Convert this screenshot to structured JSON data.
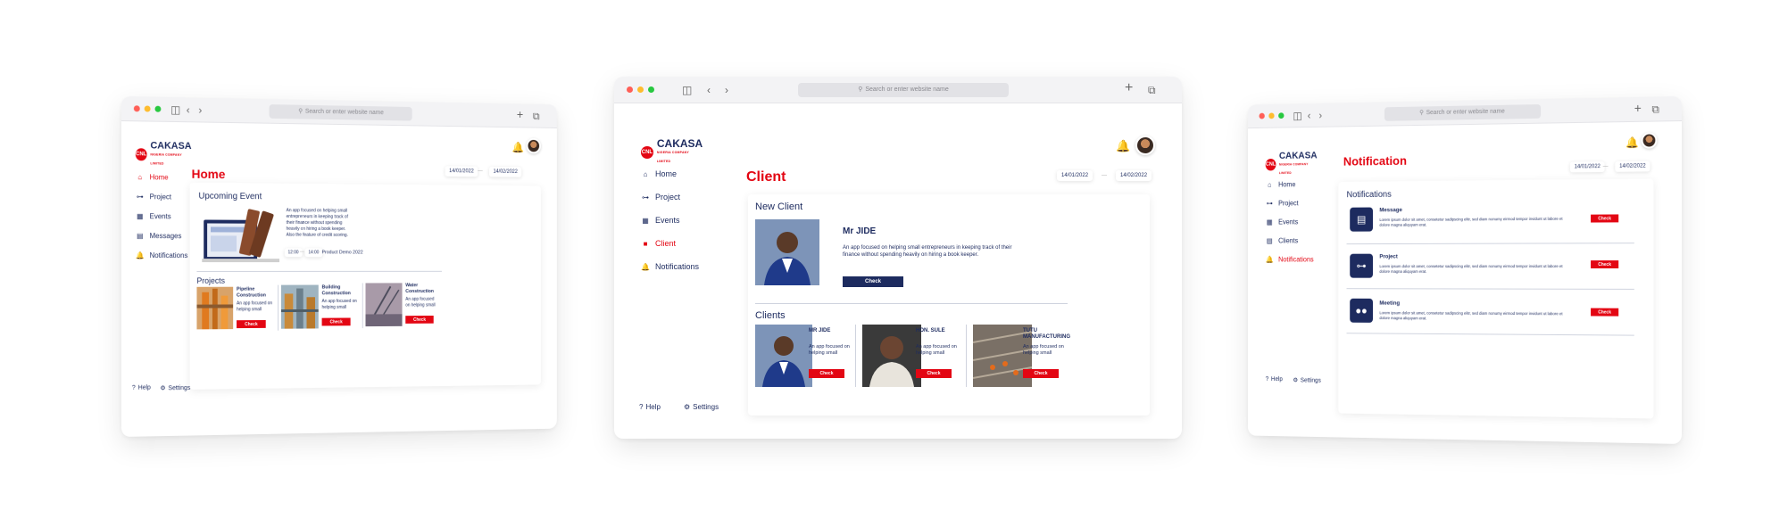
{
  "brand": {
    "name": "CAKASA",
    "tagline": "NIGERIA COMPANY LIMITED",
    "logo_mark": "CNL"
  },
  "browser": {
    "address_placeholder": "Search or enter website name"
  },
  "colors": {
    "accent": "#e30613",
    "navy": "#1d2b5f"
  },
  "nav": {
    "home": "Home",
    "project": "Project",
    "events": "Events",
    "messages": "Messages",
    "client": "Client",
    "clients": "Clients",
    "notifications": "Notifications"
  },
  "footer": {
    "help": "Help",
    "settings": "Settings"
  },
  "dates": {
    "start": "14/01/2022",
    "end": "14/02/2022"
  },
  "screen1": {
    "title": "Home",
    "upcoming_title": "Upcoming Event",
    "event_text": "An app focused on helping small entrepreneurs in keeping track of their finance without spending heavily on hiring a book keeper. Also the feature of credit scoring.",
    "time_start": "12:00",
    "time_end": "14:00",
    "event_name": "Product Demo 2022",
    "projects_title": "Projects",
    "projects": [
      {
        "name": "Pipeline Construction",
        "desc": "An app focused on helping small",
        "button": "Check"
      },
      {
        "name": "Building Construction",
        "desc": "An app focused on helping small",
        "button": "Check"
      },
      {
        "name": "Water Construction",
        "desc": "An app focused on helping small",
        "button": "Check"
      }
    ]
  },
  "screen2": {
    "title": "Client",
    "new_client_title": "New Client",
    "new_client_name": "Mr JIDE",
    "new_client_text": "An app focused on helping small entrepreneurs in keeping track of their finance without spending heavily on hiring a book keeper.",
    "new_client_button": "Check",
    "clients_title": "Clients",
    "clients": [
      {
        "name": "MR JIDE",
        "desc": "An app focused on helping small",
        "button": "Check"
      },
      {
        "name": "HON. SULE",
        "desc": "An app focused on helping small",
        "button": "Check"
      },
      {
        "name": "TUTU MANUFACTURING",
        "desc": "An app focused on helping small",
        "button": "Check"
      }
    ]
  },
  "screen3": {
    "title": "Notification",
    "panel_title": "Notifications",
    "items": [
      {
        "icon": "chat-icon",
        "title": "Message",
        "text": "Lorem ipsum dolor sit amet, consetetur sadipscing elitr, sed diam nonumy eirmod tempor invidunt ut labore et dolore magna aliquyam erat.",
        "button": "Check"
      },
      {
        "icon": "hierarchy-icon",
        "title": "Project",
        "text": "Lorem ipsum dolor sit amet, consetetur sadipscing elitr, sed diam nonumy eirmod tempor invidunt ut labore et dolore magna aliquyam erat.",
        "button": "Check"
      },
      {
        "icon": "people-icon",
        "title": "Meeting",
        "text": "Lorem ipsum dolor sit amet, consetetur sadipscing elitr, sed diam nonumy eirmod tempor invidunt ut labore et dolore magna aliquyam erat.",
        "button": "Check"
      }
    ]
  }
}
